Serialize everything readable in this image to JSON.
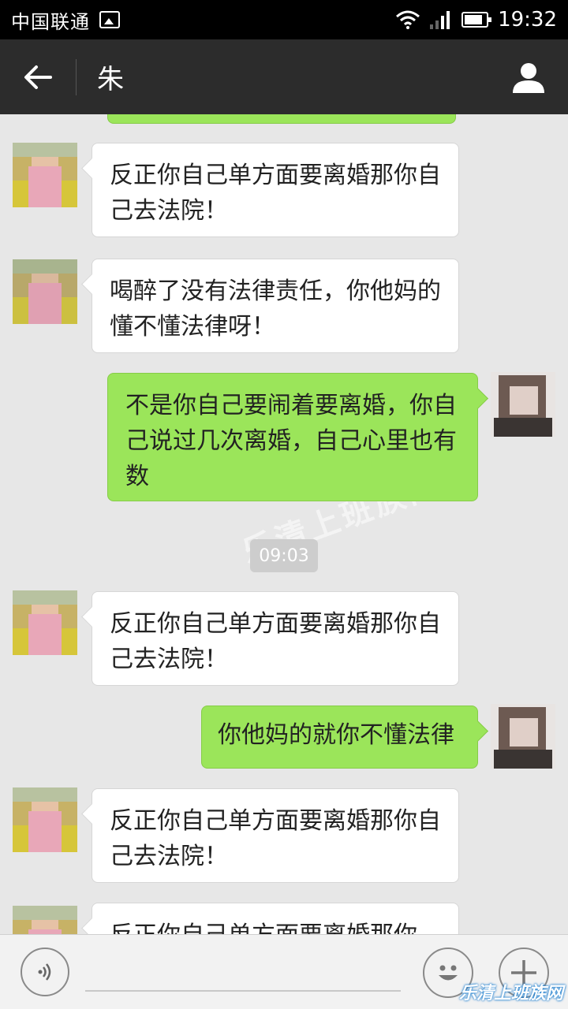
{
  "status_bar": {
    "carrier": "中国联通",
    "time": "19:32"
  },
  "header": {
    "title": "朱"
  },
  "messages": [
    {
      "side": "in",
      "text": "反正你自己单方面要离婚那你自己去法院！"
    },
    {
      "side": "in",
      "text": "喝醉了没有法律责任，你他妈的懂不懂法律呀！"
    },
    {
      "side": "out",
      "text": "不是你自己要闹着要离婚，你自己说过几次离婚，自己心里也有数"
    },
    {
      "side": "in",
      "text": "反正你自己单方面要离婚那你自己去法院！"
    },
    {
      "side": "out",
      "text": "你他妈的就你不懂法律"
    },
    {
      "side": "in",
      "text": "反正你自己单方面要离婚那你自己去法院！"
    },
    {
      "side": "in",
      "text": "反正你自己单方面要离婚那你"
    }
  ],
  "timestamp": "09:03",
  "watermark": {
    "text": "乐清上班族网",
    "corner": "乐清上班族网"
  },
  "colors": {
    "status_bar": "#000000",
    "title_bar": "#2c2c2c",
    "chat_background": "#e7e7e7",
    "incoming_bubble": "#ffffff",
    "outgoing_bubble": "#9be55a"
  },
  "icons": {
    "back": "back-arrow-icon",
    "contact": "person-icon",
    "voice": "voice-icon",
    "emoji": "smiley-icon",
    "plus": "plus-icon"
  }
}
